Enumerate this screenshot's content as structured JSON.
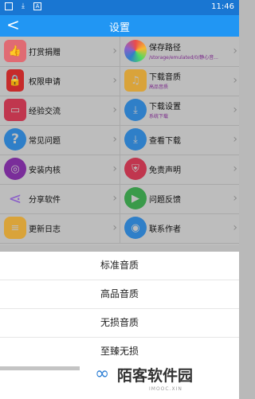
{
  "status_bar": {
    "time": "11:46",
    "icons": [
      "square-icon",
      "download-icon",
      "a-icon"
    ]
  },
  "title_bar": {
    "back_icon": "back-arrow-icon",
    "title": "设置"
  },
  "menu": {
    "rows": [
      {
        "left": {
          "label": "打赏捐赠",
          "icon": "thumbs-up-icon",
          "color": "#e06b73"
        },
        "right": {
          "label": "保存路径",
          "sub": "/storage/emulated/0/静心音...",
          "icon": "color-wheel-icon",
          "color": "#8b60c8"
        }
      },
      {
        "left": {
          "label": "权限申请",
          "icon": "lock-icon",
          "color": "#c62b2b"
        },
        "right": {
          "label": "下载音质",
          "sub": "高品音质",
          "icon": "music-note-icon",
          "color": "#d9a33a"
        }
      },
      {
        "left": {
          "label": "经验交流",
          "icon": "chat-icon",
          "color": "#c0364e"
        },
        "right": {
          "label": "下载设置",
          "sub": "系统下载",
          "icon": "download-circle-icon",
          "color": "#2f7fc8"
        }
      },
      {
        "left": {
          "label": "常见问题",
          "icon": "question-icon",
          "color": "#2f7fc8"
        },
        "right": {
          "label": "查看下载",
          "icon": "download-view-icon",
          "color": "#2f7fc8"
        }
      },
      {
        "left": {
          "label": "安装内核",
          "icon": "ring-icon",
          "color": "#7a2d9a"
        },
        "right": {
          "label": "免责声明",
          "icon": "shield-icon",
          "color": "#c0364e"
        }
      },
      {
        "left": {
          "label": "分享软件",
          "icon": "share-icon",
          "color": "#8b60c8"
        },
        "right": {
          "label": "问题反馈",
          "icon": "play-store-icon",
          "color": "#3a9a4a"
        }
      },
      {
        "left": {
          "label": "更新日志",
          "icon": "coins-icon",
          "color": "#d9a33a"
        },
        "right": {
          "label": "联系作者",
          "icon": "qq-icon",
          "color": "#2f7fc8"
        }
      }
    ]
  },
  "sheet": {
    "options": [
      "标准音质",
      "高品音质",
      "无损音质",
      "至臻无损"
    ]
  },
  "watermark": {
    "text": "陌客软件园",
    "url": "IMOOC.XIN"
  }
}
